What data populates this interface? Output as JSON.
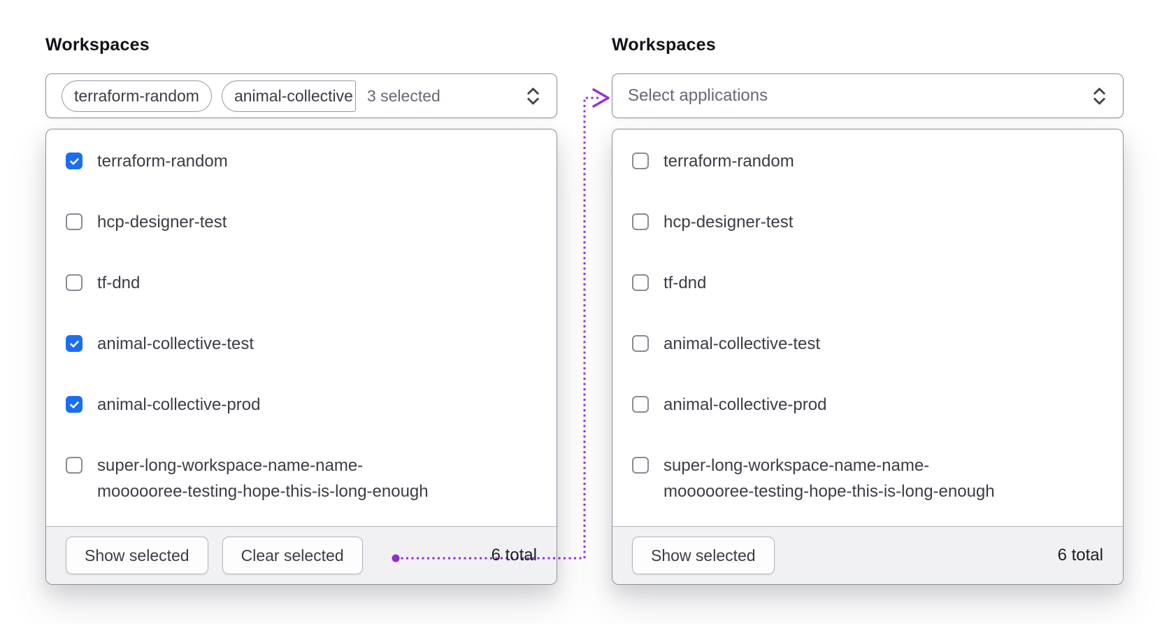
{
  "colors": {
    "checkbox_checked": "#1b6ef3",
    "connector_purple": "#9a2fd8",
    "footer_background": "#f1f1f3",
    "border_gray": "#8b8f99"
  },
  "icons": {
    "trigger_caret": "chevron-up-down-icon",
    "checkbox_check": "check-icon",
    "connector": "dotted-arrow-connector"
  },
  "left_panel": {
    "label": "Workspaces",
    "trigger": {
      "tags": [
        "terraform-random",
        "animal-collective"
      ],
      "summary": "3 selected"
    },
    "options": [
      {
        "label": "terraform-random",
        "checked": true
      },
      {
        "label": "hcp-designer-test",
        "checked": false
      },
      {
        "label": "tf-dnd",
        "checked": false
      },
      {
        "label": "animal-collective-test",
        "checked": true
      },
      {
        "label": "animal-collective-prod",
        "checked": true
      },
      {
        "label": [
          "super-long-workspace-name-name-",
          "moooooree-testing-hope-this-is-long-enough"
        ],
        "checked": false
      }
    ],
    "footer": {
      "buttons": [
        {
          "name": "show-selected",
          "label": "Show selected"
        },
        {
          "name": "clear-selected",
          "label": "Clear selected"
        }
      ],
      "total": "6 total"
    }
  },
  "right_panel": {
    "label": "Workspaces",
    "trigger": {
      "placeholder": "Select applications"
    },
    "options": [
      {
        "label": "terraform-random",
        "checked": false
      },
      {
        "label": "hcp-designer-test",
        "checked": false
      },
      {
        "label": "tf-dnd",
        "checked": false
      },
      {
        "label": "animal-collective-test",
        "checked": false
      },
      {
        "label": "animal-collective-prod",
        "checked": false
      },
      {
        "label": [
          "super-long-workspace-name-name-",
          "moooooree-testing-hope-this-is-long-enough"
        ],
        "checked": false
      }
    ],
    "footer": {
      "buttons": [
        {
          "name": "show-selected",
          "label": "Show selected"
        }
      ],
      "total": "6 total"
    }
  }
}
